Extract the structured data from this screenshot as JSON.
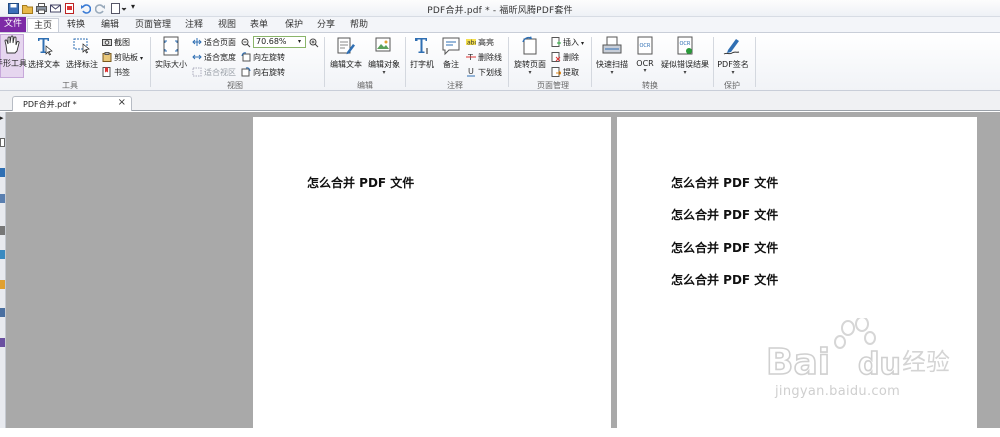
{
  "window": {
    "title": "PDF合并.pdf * - 福昕风腾PDF套件"
  },
  "ribbon_tabs": [
    "文件",
    "主页",
    "转换",
    "编辑",
    "页面管理",
    "注释",
    "视图",
    "表单",
    "保护",
    "分享",
    "帮助"
  ],
  "active_tab": "主页",
  "ribbon": {
    "tools": {
      "hand": "手形工具",
      "select_text": "选择文本",
      "select_annot": "选择标注",
      "screenshot": "截图",
      "clipboard": "剪贴板",
      "bookmark": "书签",
      "group": "工具"
    },
    "view": {
      "actual_size": "实际大小",
      "fit_page": "适合页面",
      "fit_width": "适合宽度",
      "fit_visible": "适合视区",
      "zoom_value": "70.68%",
      "rotate_left": "向左旋转",
      "rotate_right": "向右旋转",
      "group": "视图"
    },
    "edit": {
      "edit_text": "编辑文本",
      "edit_object": "编辑对象",
      "group": "编辑"
    },
    "comment": {
      "typewriter": "打字机",
      "note": "备注",
      "highlight": "高亮",
      "strikeout": "删除线",
      "underline": "下划线",
      "group": "注释"
    },
    "pages": {
      "rotate_page": "旋转页面",
      "insert": "插入",
      "delete": "删除",
      "extract": "提取",
      "group": "页面管理"
    },
    "convert": {
      "quick_scan": "快速扫描",
      "ocr": "OCR",
      "ocr_suspects": "疑似错误结果",
      "group": "转换"
    },
    "protect": {
      "pdf_sign": "PDF签名",
      "group": "保护"
    }
  },
  "document_tab": {
    "label": "PDF合并.pdf *"
  },
  "pages": {
    "page1_lines": [
      "怎么合并 PDF 文件"
    ],
    "page2_lines": [
      "怎么合并 PDF 文件",
      "怎么合并 PDF 文件",
      "怎么合并 PDF 文件",
      "怎么合并 PDF 文件"
    ]
  },
  "watermark": {
    "brand": "Bai du 经验",
    "url": "jingyan.baidu.com"
  },
  "colors": {
    "file_tab": "#7d2aa6",
    "workspace": "#a9a9a9",
    "accent_blue": "#2f6fb3"
  }
}
